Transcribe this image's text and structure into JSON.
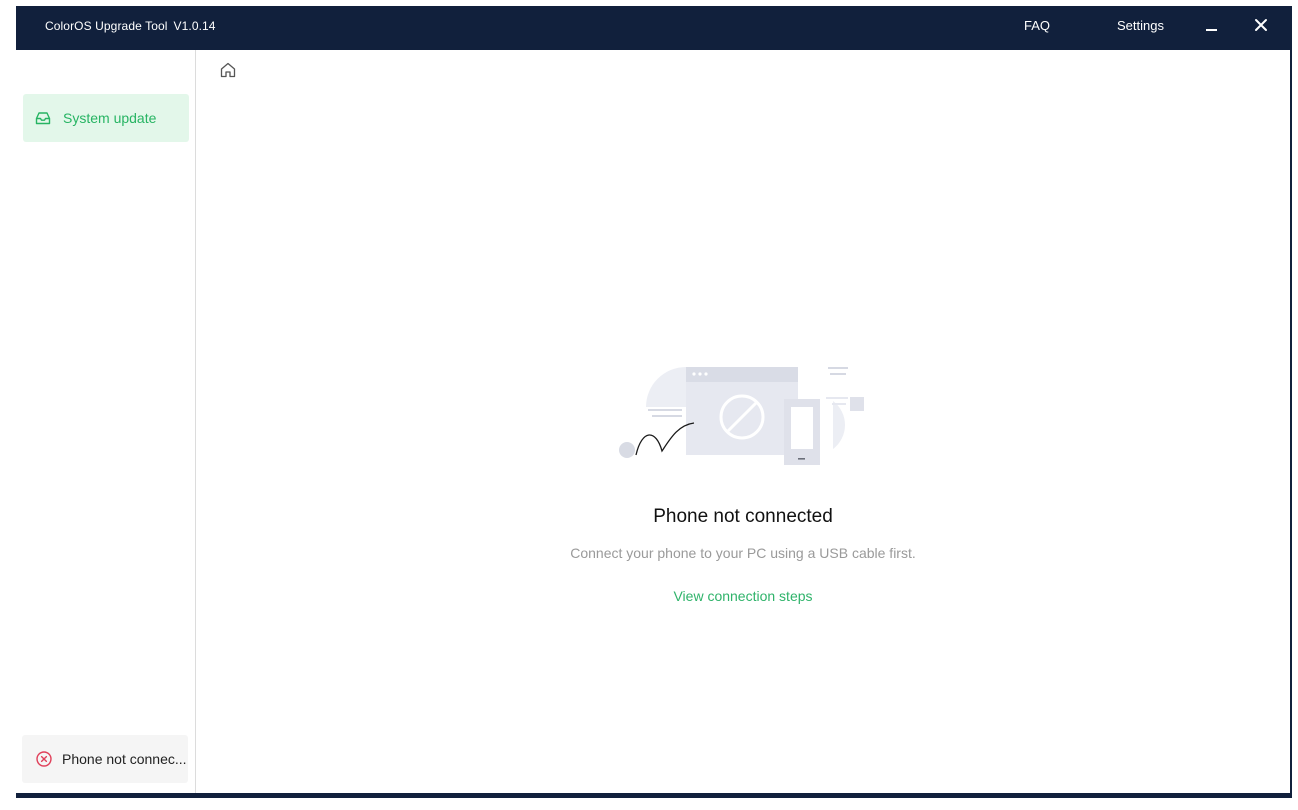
{
  "titlebar": {
    "app_name": "ColorOS Upgrade Tool",
    "version": "V1.0.14",
    "faq_label": "FAQ",
    "settings_label": "Settings"
  },
  "sidebar": {
    "items": [
      {
        "label": "System update",
        "icon": "inbox-icon",
        "active": true
      }
    ],
    "status": {
      "label": "Phone not connec...",
      "icon": "error-circle-icon"
    }
  },
  "main": {
    "breadcrumb_icon": "home-icon",
    "empty_state": {
      "title": "Phone not connected",
      "description": "Connect your phone to your PC using a USB cable first.",
      "link": "View connection steps"
    }
  },
  "colors": {
    "titlebar_bg": "#11203c",
    "accent_green": "#27b463",
    "active_item_bg": "#e3f7ea",
    "error_red": "#e0405a",
    "muted_text": "#9a9a9a"
  }
}
